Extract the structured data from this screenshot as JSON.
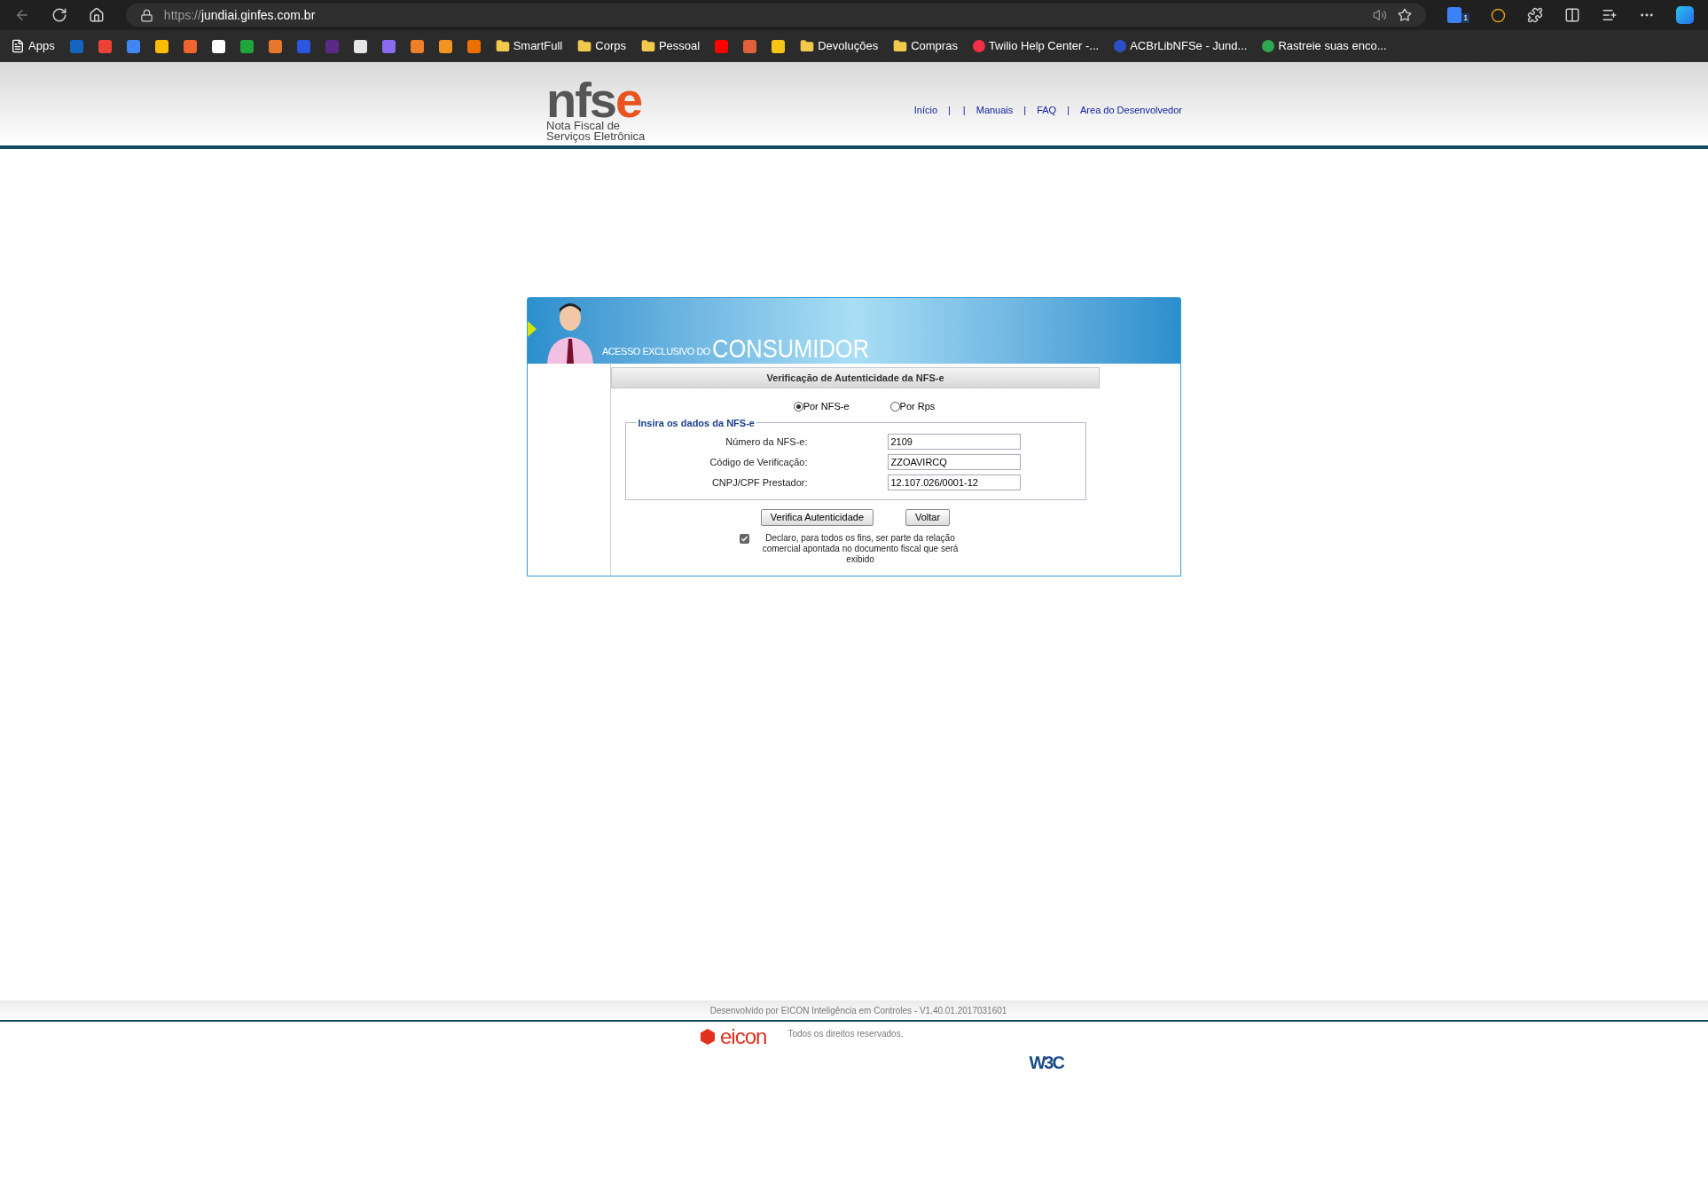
{
  "browser": {
    "url_scheme": "https://",
    "url_host": "jundiai.ginfes.com.br",
    "extension_badge": "1",
    "bookmarks": [
      {
        "kind": "page",
        "label": "Apps"
      },
      {
        "kind": "icon",
        "color": "#1565c0"
      },
      {
        "kind": "icon",
        "color": "#ea4335"
      },
      {
        "kind": "icon",
        "color": "#4285f4"
      },
      {
        "kind": "icon",
        "color": "#fbbc04"
      },
      {
        "kind": "icon",
        "color": "#f0642d"
      },
      {
        "kind": "icon",
        "color": "#ffffff"
      },
      {
        "kind": "icon",
        "color": "#1fa53b"
      },
      {
        "kind": "icon",
        "color": "#e8772e"
      },
      {
        "kind": "icon",
        "color": "#2b57e0"
      },
      {
        "kind": "icon",
        "color": "#5b2a86"
      },
      {
        "kind": "icon",
        "color": "#e6e6e6"
      },
      {
        "kind": "icon",
        "color": "#8b6cf0"
      },
      {
        "kind": "icon",
        "color": "#f07f2a"
      },
      {
        "kind": "icon",
        "color": "#f39422"
      },
      {
        "kind": "icon",
        "color": "#ec7000"
      },
      {
        "kind": "folder",
        "label": "SmartFull"
      },
      {
        "kind": "folder",
        "label": "Corps"
      },
      {
        "kind": "folder",
        "label": "Pessoal"
      },
      {
        "kind": "icon",
        "color": "#ff0000"
      },
      {
        "kind": "icon",
        "color": "#e0603a"
      },
      {
        "kind": "icon",
        "color": "#f5c518"
      },
      {
        "kind": "folder",
        "label": "Devoluções"
      },
      {
        "kind": "folder",
        "label": "Compras"
      },
      {
        "kind": "site",
        "label": "Twilio Help Center -...",
        "color": "#f22f46"
      },
      {
        "kind": "site",
        "label": "ACBrLibNFSe - Jund...",
        "color": "#2b4fc4"
      },
      {
        "kind": "site",
        "label": "Rastreie suas enco...",
        "color": "#2fa84f"
      }
    ]
  },
  "header": {
    "logo_main": "nfs",
    "logo_accent": "e",
    "tagline": [
      "Nota Fiscal de",
      "Serviços Eletrônica"
    ],
    "nav": [
      {
        "kind": "link",
        "label": "Início"
      },
      {
        "kind": "separator",
        "label": "|"
      },
      {
        "kind": "separator",
        "label": "|"
      },
      {
        "kind": "link",
        "label": "Manuais"
      },
      {
        "kind": "separator",
        "label": "|"
      },
      {
        "kind": "link",
        "label": "FAQ"
      },
      {
        "kind": "separator",
        "label": "|"
      },
      {
        "kind": "link",
        "label": "Area do Desenvolvedor"
      }
    ]
  },
  "banner": {
    "prefix": "ACESSO EXCLUSIVO DO",
    "title": "CONSUMIDOR"
  },
  "form": {
    "title": "Verificação de Autenticidade da NFS-e",
    "modes": [
      {
        "label": "Por NFS-e",
        "selected": true
      },
      {
        "label": "Por Rps",
        "selected": false
      }
    ],
    "legend": "Insira os dados da NFS-e",
    "fields": [
      {
        "label": "Número da NFS-e:",
        "value": "2109"
      },
      {
        "label": "Código de Verificação:",
        "value": "ZZOAVIRCQ"
      },
      {
        "label": "CNPJ/CPF Prestador:",
        "value": "12.107.026/0001-12"
      }
    ],
    "buttons": [
      "Verifica Autenticidade",
      "Voltar"
    ],
    "declaration": {
      "checked": true,
      "text": "Declaro, para todos os fins, ser parte da relação comercial apontada no documento fiscal que será exibido"
    }
  },
  "footer": {
    "developer": "Desenvolvido por EICON Inteligência em Controles - V1.40.01.2017031601",
    "company_logo": "eicon",
    "rights": "Todos os direitos reservados.",
    "w3c": "W3C"
  }
}
